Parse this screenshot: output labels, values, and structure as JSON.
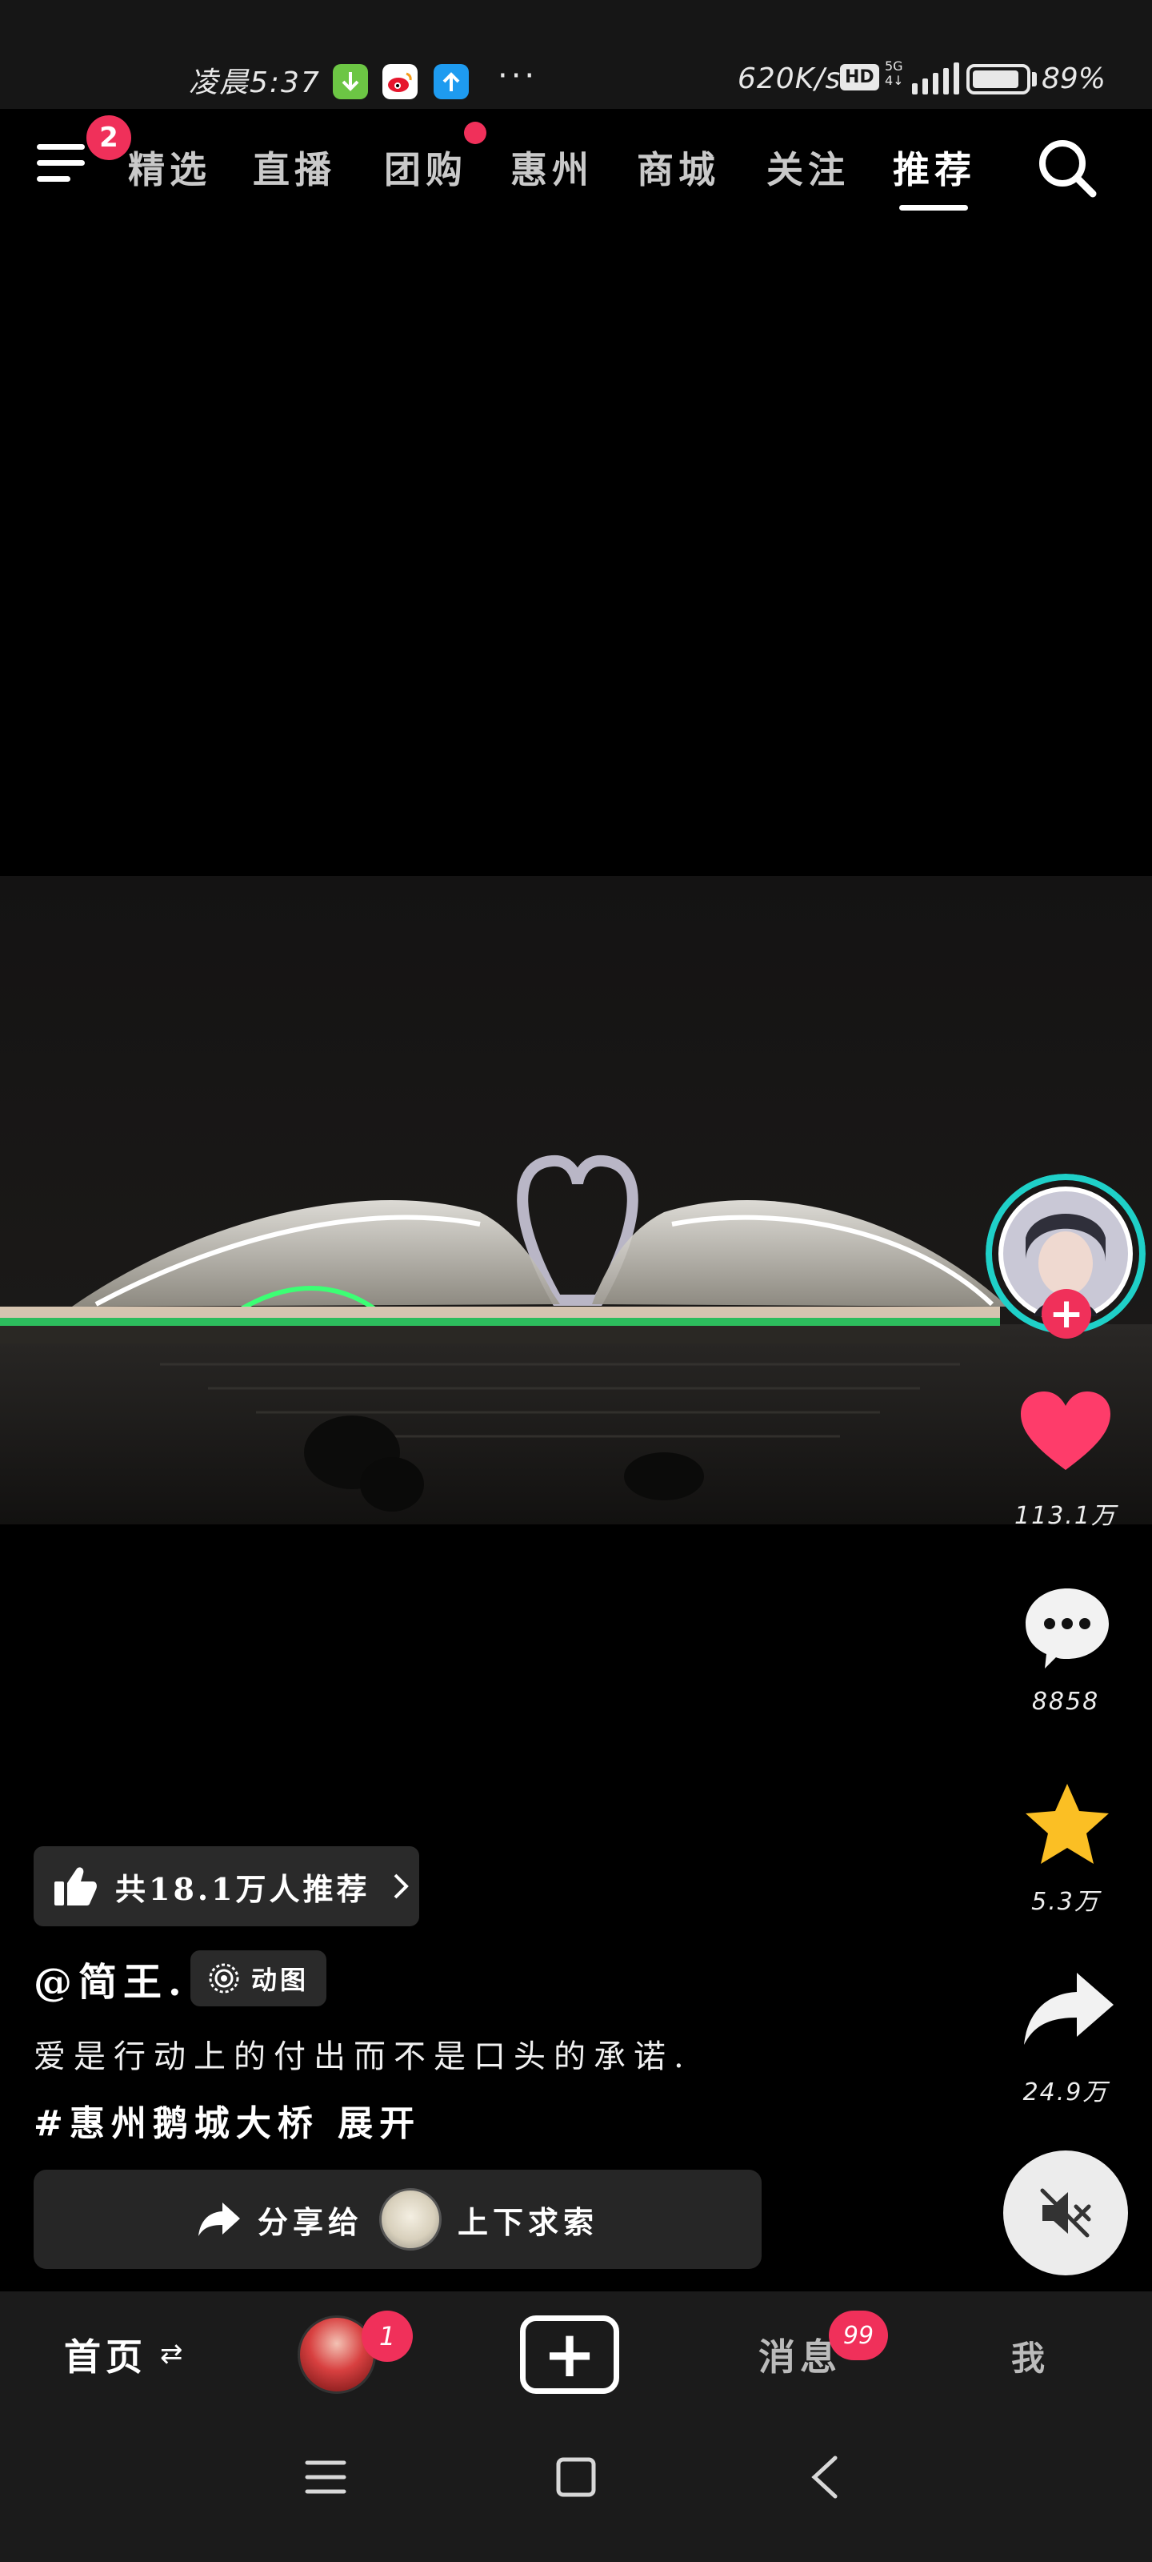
{
  "status_bar": {
    "time": "凌晨5:37",
    "dots": "···",
    "net_speed": "620K/s",
    "hd": "HD",
    "network_type_top": "5G",
    "network_type_bottom": "4↓",
    "battery_percent": 89,
    "battery_label": "89%"
  },
  "top_nav": {
    "menu_badge": "2",
    "tabs": [
      "精选",
      "直播",
      "团购",
      "惠州",
      "商城",
      "关注",
      "推荐"
    ],
    "active_tab": "推荐"
  },
  "actions": {
    "likes": "113.1万",
    "comments": "8858",
    "favorites": "5.3万",
    "shares": "24.9万",
    "follow_symbol": "+"
  },
  "post": {
    "recommend_text": "共18.1万人推荐",
    "author": "@简王.",
    "gif_label": "动图",
    "caption": "爱是行动上的付出而不是口头的承诺.",
    "hashtag": "#惠州鹅城大桥 展开",
    "share_prefix": "分享给",
    "share_target": "上下求索"
  },
  "tab_bar": {
    "home": "首页",
    "home_switch": "⇄",
    "avatar_badge": "1",
    "plus": "+",
    "messages": "消息",
    "messages_badge": "99",
    "me": "我"
  },
  "colors": {
    "accent": "#f0305a",
    "star": "#fbbf24",
    "bar_bg": "#1b1b1b"
  }
}
